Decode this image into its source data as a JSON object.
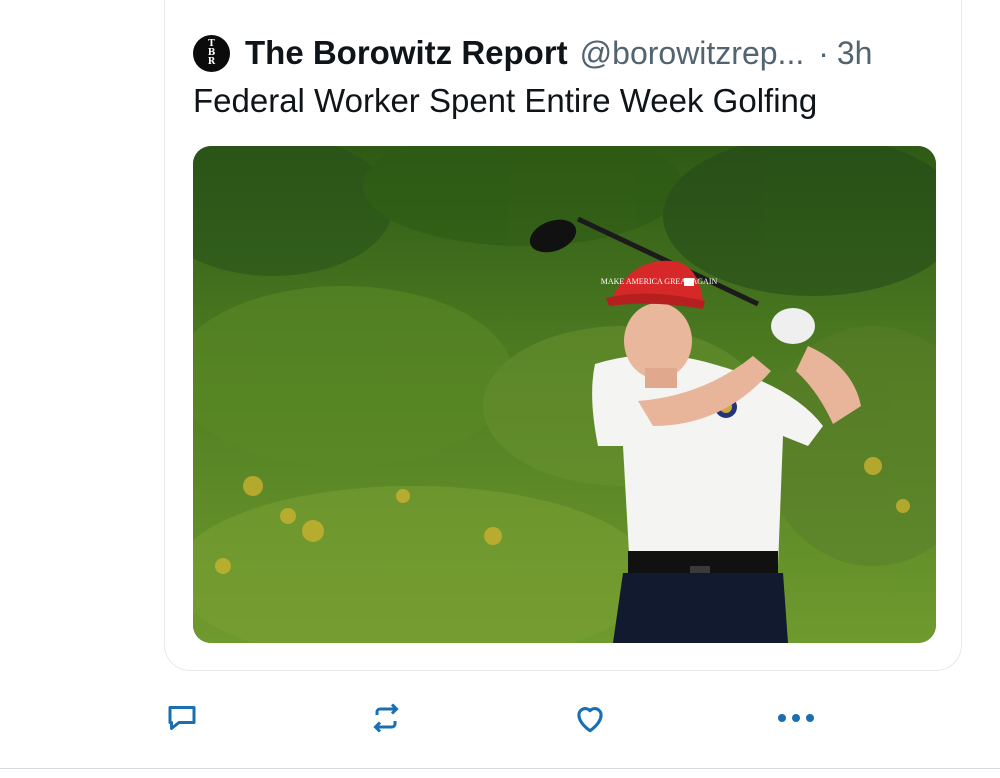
{
  "post": {
    "author": {
      "name": "The Borowitz Report",
      "handle": "@borowitzrep...",
      "avatar_text": "TBR"
    },
    "separator": "·",
    "timestamp": "3h",
    "text": "Federal Worker Spent Entire Week Golfing",
    "media": {
      "kind": "photo",
      "hat_text": "MAKE AMERICA GREAT AGAIN"
    }
  },
  "actions": [
    {
      "icon": "reply-icon"
    },
    {
      "icon": "repost-icon"
    },
    {
      "icon": "like-icon"
    },
    {
      "icon": "more-icon"
    }
  ],
  "colors": {
    "text_primary": "#0f1419",
    "text_secondary": "#536471",
    "icon": "#1a6fb3",
    "border": "#e6e9ec"
  }
}
